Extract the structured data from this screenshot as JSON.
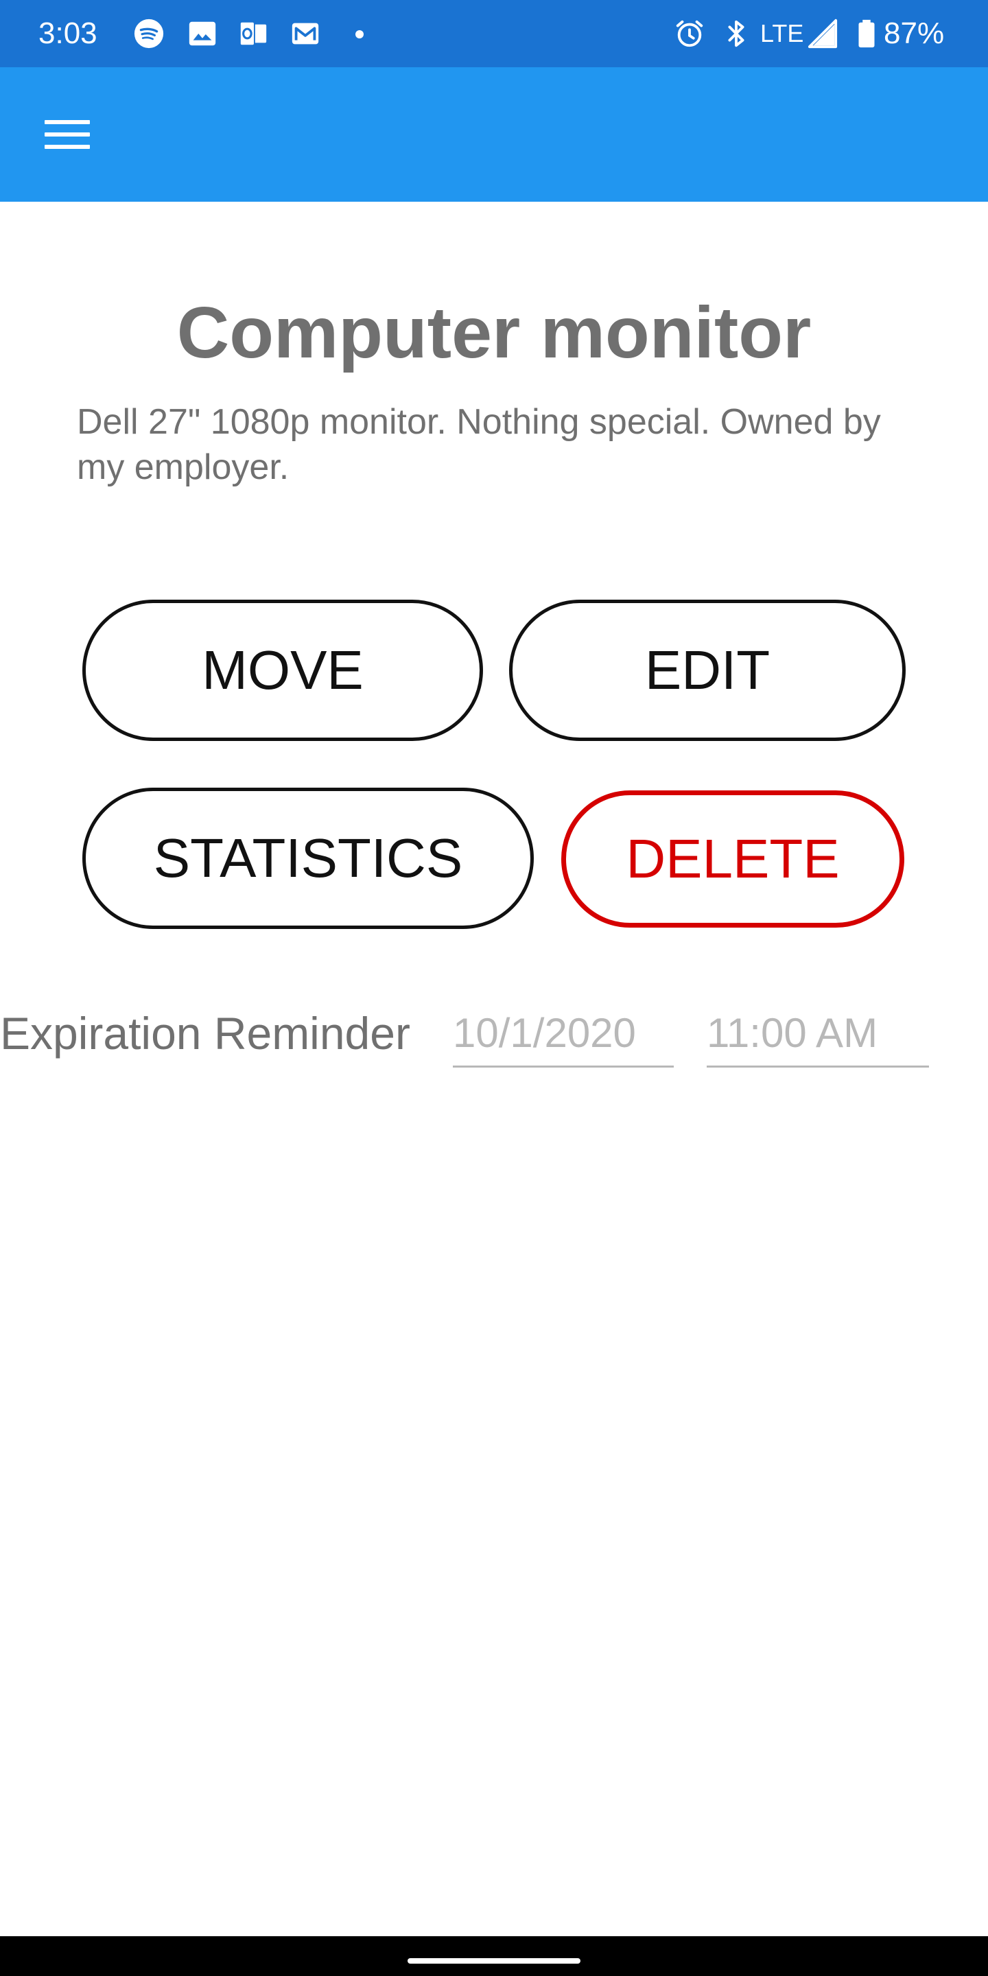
{
  "status_bar": {
    "time": "3:03",
    "notification_icons": [
      "spotify-icon",
      "image-icon",
      "outlook-icon",
      "gmail-icon",
      "more-dot-icon"
    ],
    "system_icons": [
      "alarm-icon",
      "bluetooth-icon",
      "signal-icon",
      "battery-icon"
    ],
    "network": "LTE",
    "battery": "87%"
  },
  "app_bar": {
    "menu_icon": "hamburger-menu-icon",
    "color": "#2196f0"
  },
  "item": {
    "title": "Computer monitor",
    "description": "Dell 27\" 1080p monitor. Nothing special. Owned by my employer."
  },
  "actions": {
    "move_label": "MOVE",
    "edit_label": "EDIT",
    "statistics_label": "STATISTICS",
    "delete_label": "DELETE",
    "delete_color": "#d50000"
  },
  "reminder": {
    "label": "Expiration Reminder",
    "date": "10/1/2020",
    "time": "11:00 AM"
  },
  "colors": {
    "status_bar": "#1a73d2",
    "text_gray": "#707070",
    "hint_gray": "#b8b8b8"
  }
}
